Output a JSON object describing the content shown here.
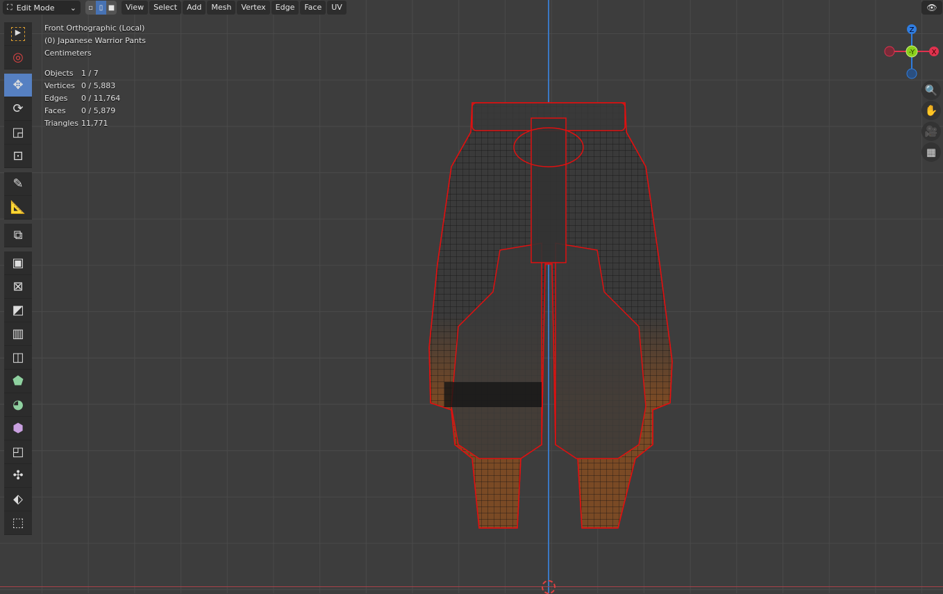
{
  "header": {
    "mode": "Edit Mode",
    "menus": [
      "View",
      "Select",
      "Add",
      "Mesh",
      "Vertex",
      "Edge",
      "Face",
      "UV"
    ]
  },
  "overlay": {
    "view": "Front Orthographic (Local)",
    "object": "(0) Japanese Warrior Pants",
    "units": "Centimeters",
    "stats": [
      {
        "label": "Objects",
        "value": "1 / 7"
      },
      {
        "label": "Vertices",
        "value": "0 / 5,883"
      },
      {
        "label": "Edges",
        "value": "0 / 11,764"
      },
      {
        "label": "Faces",
        "value": "0 / 5,879"
      },
      {
        "label": "Triangles",
        "value": "11,771"
      }
    ]
  },
  "gizmo": {
    "z": "Z",
    "y": "-Y",
    "x": "X"
  },
  "colors": {
    "accent": "#4772b3",
    "x_axis": "#e0324e",
    "y_axis": "#8bd11b",
    "z_axis": "#2f7de0"
  }
}
